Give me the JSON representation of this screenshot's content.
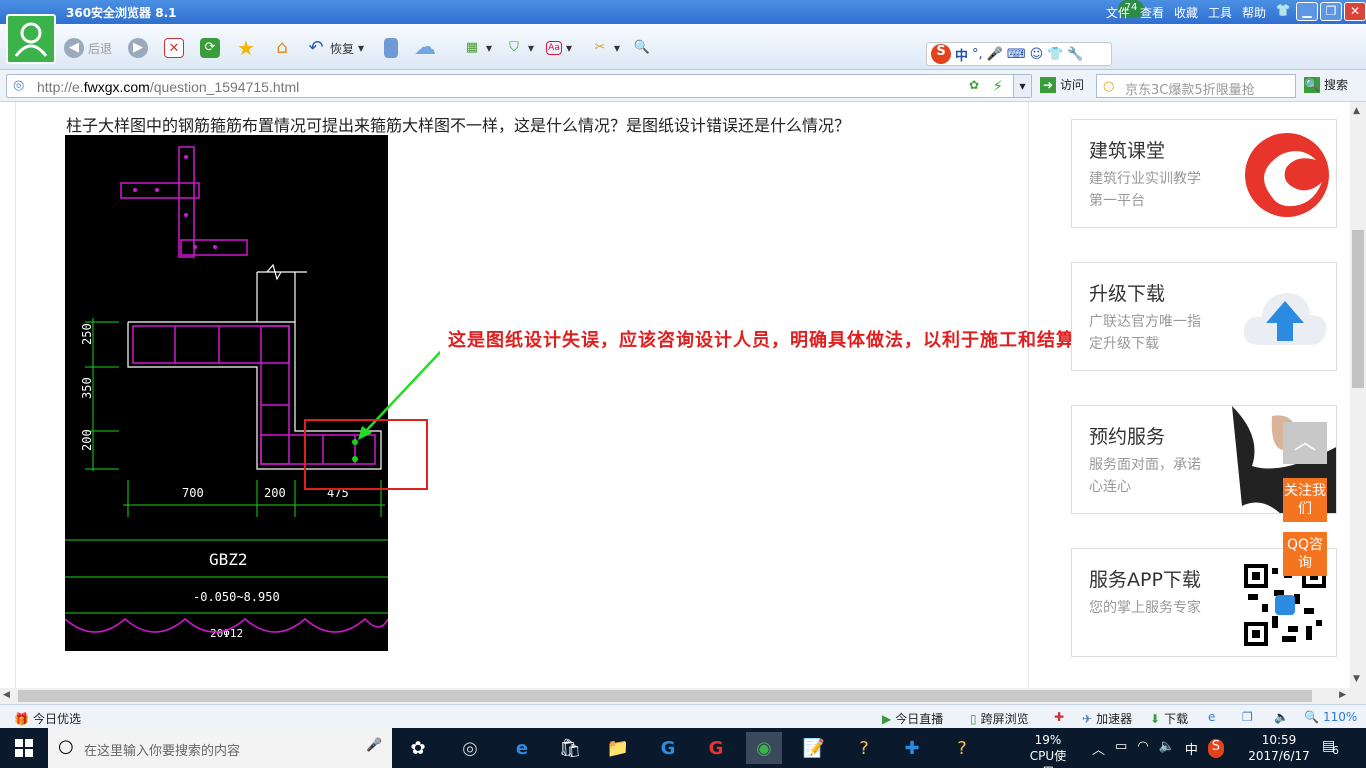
{
  "browser": {
    "title": "360安全浏览器 8.1",
    "badge": "74",
    "menu": [
      "文件",
      "查看",
      "收藏",
      "工具",
      "帮助"
    ]
  },
  "toolbar": {
    "back": "后退",
    "restore": "恢复"
  },
  "ime": {
    "label": "中"
  },
  "address": {
    "url_prefix": "http://e.",
    "url_domain": "fwxgx.com",
    "url_path": "/question_1594715.html",
    "visit": "访问",
    "search_placeholder": "京东3C爆款5折限量抢",
    "search": "搜索"
  },
  "page": {
    "question": "柱子大样图中的钢筋箍筋布置情况可提出来箍筋大样图不一样，这是什么情况？是图纸设计错误还是什么情况？",
    "annotation": "这是图纸设计失误，应该咨询设计人员，明确具体做法，以利于施工和结算",
    "drawing": {
      "dims_vertical": [
        "250",
        "350",
        "200"
      ],
      "dims_horizontal": [
        "700",
        "200",
        "475"
      ],
      "label": "GBZ2",
      "range": "-0.050~8.950",
      "rebar": "20Φ12"
    }
  },
  "sidebar": [
    {
      "title": "建筑课堂",
      "desc": "建筑行业实训教学第一平台"
    },
    {
      "title": "升级下载",
      "desc": "广联达官方唯一指定升级下载"
    },
    {
      "title": "预约服务",
      "desc": "服务面对面，承诺心连心"
    },
    {
      "title": "服务APP下载",
      "desc": "您的掌上服务专家"
    }
  ],
  "floats": {
    "follow": "关注我们",
    "qq": "QQ咨询"
  },
  "statusbar": {
    "left": "今日优选",
    "live": "今日直播",
    "crossscreen": "跨屏浏览",
    "accel": "加速器",
    "download": "下载",
    "zoom": "110%"
  },
  "taskbar": {
    "search_placeholder": "在这里输入你要搜索的内容",
    "cpu_percent": "19%",
    "cpu_label": "CPU使用",
    "ime": "中",
    "time": "10:59",
    "date": "2017/6/17",
    "notifications": "6"
  }
}
